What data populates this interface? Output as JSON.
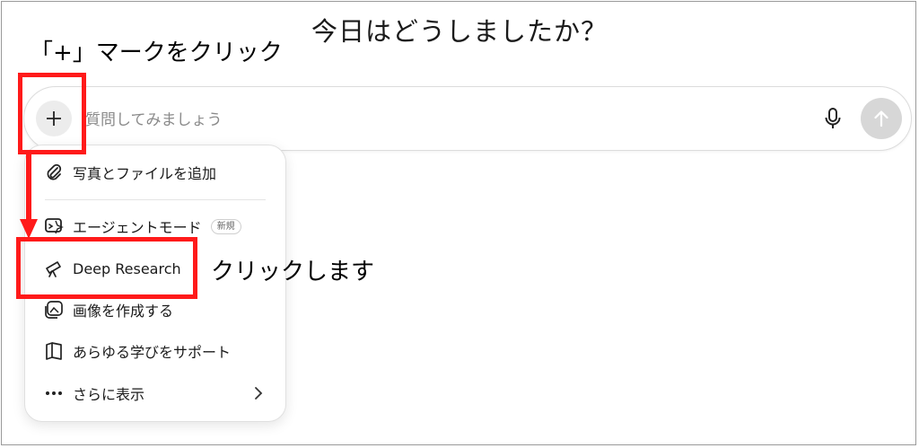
{
  "headline": "今日はどうしましたか？",
  "instruction": "「+」マークをクリック",
  "callout": "クリックします",
  "composer": {
    "placeholder": "質問してみましょう"
  },
  "menu": {
    "items": [
      {
        "label": "写真とファイルを追加",
        "icon": "paperclip-icon"
      },
      {
        "label": "エージェントモード",
        "icon": "agent-icon",
        "badge": "新規"
      },
      {
        "label": "Deep Research",
        "icon": "telescope-icon"
      },
      {
        "label": "画像を作成する",
        "icon": "image-create-icon"
      },
      {
        "label": "あらゆる学びをサポート",
        "icon": "book-icon"
      },
      {
        "label": "さらに表示",
        "icon": "more-dots-icon"
      }
    ]
  },
  "colors": {
    "highlight": "#ff1a1a",
    "send_button": "#d7d7d7",
    "plus_button": "#ececec"
  }
}
